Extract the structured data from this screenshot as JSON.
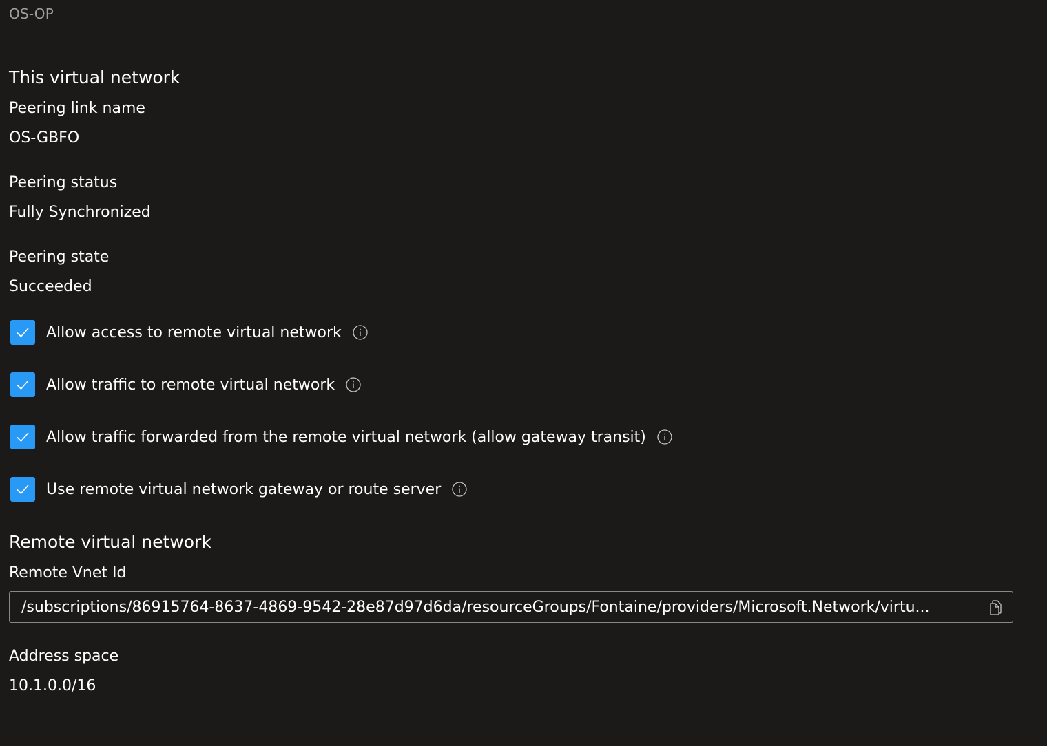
{
  "breadcrumb": "OS-OP",
  "this_network": {
    "title": "This virtual network",
    "peering_link_name_label": "Peering link name",
    "peering_link_name_value": "OS-GBFO",
    "peering_status_label": "Peering status",
    "peering_status_value": "Fully Synchronized",
    "peering_state_label": "Peering state",
    "peering_state_value": "Succeeded"
  },
  "options": [
    {
      "label": "Allow access to remote virtual network",
      "checked": true
    },
    {
      "label": "Allow traffic to remote virtual network",
      "checked": true
    },
    {
      "label": "Allow traffic forwarded from the remote virtual network (allow gateway transit)",
      "checked": true
    },
    {
      "label": "Use remote virtual network gateway or route server",
      "checked": true
    }
  ],
  "remote_network": {
    "title": "Remote virtual network",
    "vnet_id_label": "Remote Vnet Id",
    "vnet_id_value": "/subscriptions/86915764-8637-4869-9542-28e87d97d6da/resourceGroups/Fontaine/providers/Microsoft.Network/virtu...",
    "address_space_label": "Address space",
    "address_space_value": "10.1.0.0/16"
  },
  "colors": {
    "background": "#1b1a19",
    "checkbox_accent": "#2899f5",
    "muted_text": "#a19f9d",
    "input_border": "#8a8886"
  },
  "icons": {
    "checkbox": "checkmark-icon",
    "info": "info-icon",
    "copy": "copy-icon"
  }
}
